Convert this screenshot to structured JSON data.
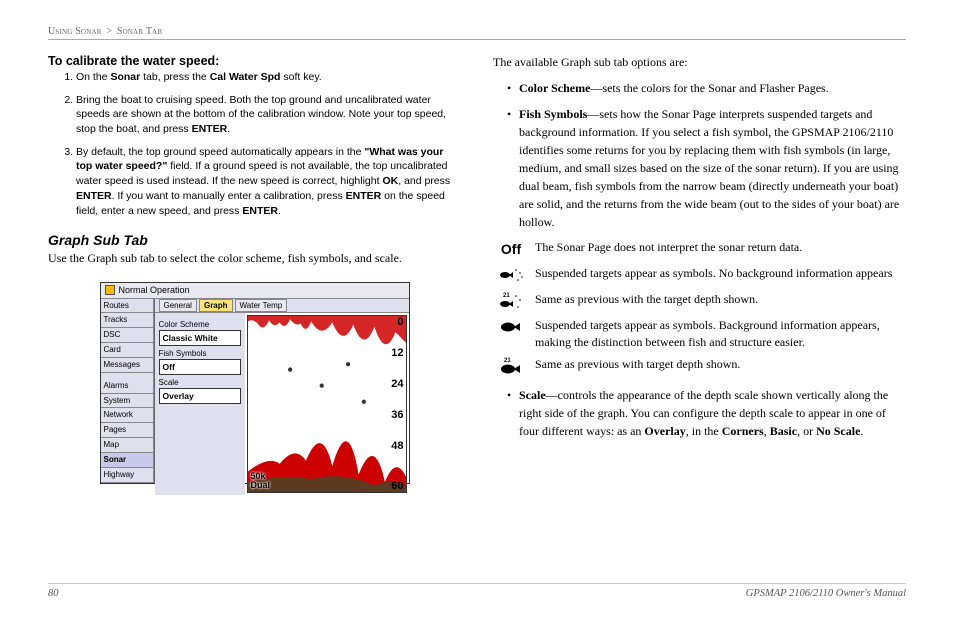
{
  "header": {
    "breadcrumb1": "Using Sonar",
    "sep": ">",
    "breadcrumb2": "Sonar Tab"
  },
  "left": {
    "calibrate_title": "To calibrate the water speed:",
    "steps": [
      {
        "pre": "On the ",
        "b1": "Sonar",
        "mid1": " tab, press the ",
        "b2": "Cal Water Spd",
        "post": " soft key."
      },
      {
        "pre": "Bring the boat to cruising speed. Both the top ground and uncalibrated water speeds are shown at the bottom of the calibration window. Note your top speed, stop the boat, and press ",
        "b1": "ENTER",
        "post": "."
      },
      {
        "pre": "By default, the top ground speed automatically appears in the ",
        "b1": "\"What was your top water speed?\"",
        "mid1": " field. If a ground speed is not available, the top uncalibrated water speed is used instead. If the new speed is correct, highlight ",
        "b2": "OK",
        "mid2": ", and press ",
        "b3": "ENTER",
        "mid3": ". If you want to manually enter a calibration, press ",
        "b4": "ENTER",
        "mid4": " on the speed field, enter a new speed, and press ",
        "b5": "ENTER",
        "post": "."
      }
    ],
    "graph_title": "Graph Sub Tab",
    "graph_intro": "Use the Graph sub tab to select the color scheme, fish symbols, and scale."
  },
  "screenshot": {
    "title": "Normal Operation",
    "sidebar": [
      "Routes",
      "Tracks",
      "DSC",
      "Card",
      "Messages",
      "",
      "Alarms",
      "System",
      "Network",
      "Pages",
      "Map",
      "Sonar",
      "Highway"
    ],
    "sidebar_selected": "Sonar",
    "tabs": [
      "General",
      "Graph",
      "Water Temp"
    ],
    "tab_active": "Graph",
    "fields": {
      "color_label": "Color Scheme",
      "color_value": "Classic White",
      "fish_label": "Fish Symbols",
      "fish_value": "Off",
      "scale_label": "Scale",
      "scale_value": "Overlay"
    },
    "scale_nums": [
      "0",
      "12",
      "24",
      "36",
      "48",
      "60"
    ],
    "bottom_freq": "50k",
    "bottom_mode": "Dual"
  },
  "right": {
    "intro": "The available Graph sub tab options are:",
    "bullets": [
      {
        "b": "Color Scheme",
        "text": "—sets the colors for the Sonar and Flasher Pages."
      },
      {
        "b": "Fish Symbols",
        "text": "—sets how the Sonar Page interprets suspended targets and background information. If you select a fish symbol, the GPSMAP 2106/2110 identifies some returns for you by replacing them with fish symbols (in large, medium, and small sizes based on the size of the sonar return). If you are using dual beam, fish symbols from the narrow beam (directly underneath your boat) are solid, and the returns from the wide beam (out to the sides of your boat) are hollow."
      }
    ],
    "icon_items": [
      "The Sonar Page does not interpret the sonar return data.",
      "Suspended targets appear as symbols. No background information appears",
      "Same as previous with the target depth shown.",
      "Suspended targets appear as symbols. Background information appears, making the distinction between fish and structure easier.",
      "Same as previous with target depth shown."
    ],
    "scale_bullet": {
      "b": "Scale",
      "pre": "—controls the appearance of the depth scale shown vertically along the right side of the graph. You can configure the depth scale to appear in one of four different ways: as an ",
      "b1": "Overlay",
      "m1": ", in the ",
      "b2": "Corners",
      "m2": ", ",
      "b3": "Basic",
      "m3": ", or ",
      "b4": "No Scale",
      "post": "."
    }
  },
  "footer": {
    "page": "80",
    "manual": "GPSMAP 2106/2110 Owner's Manual"
  }
}
